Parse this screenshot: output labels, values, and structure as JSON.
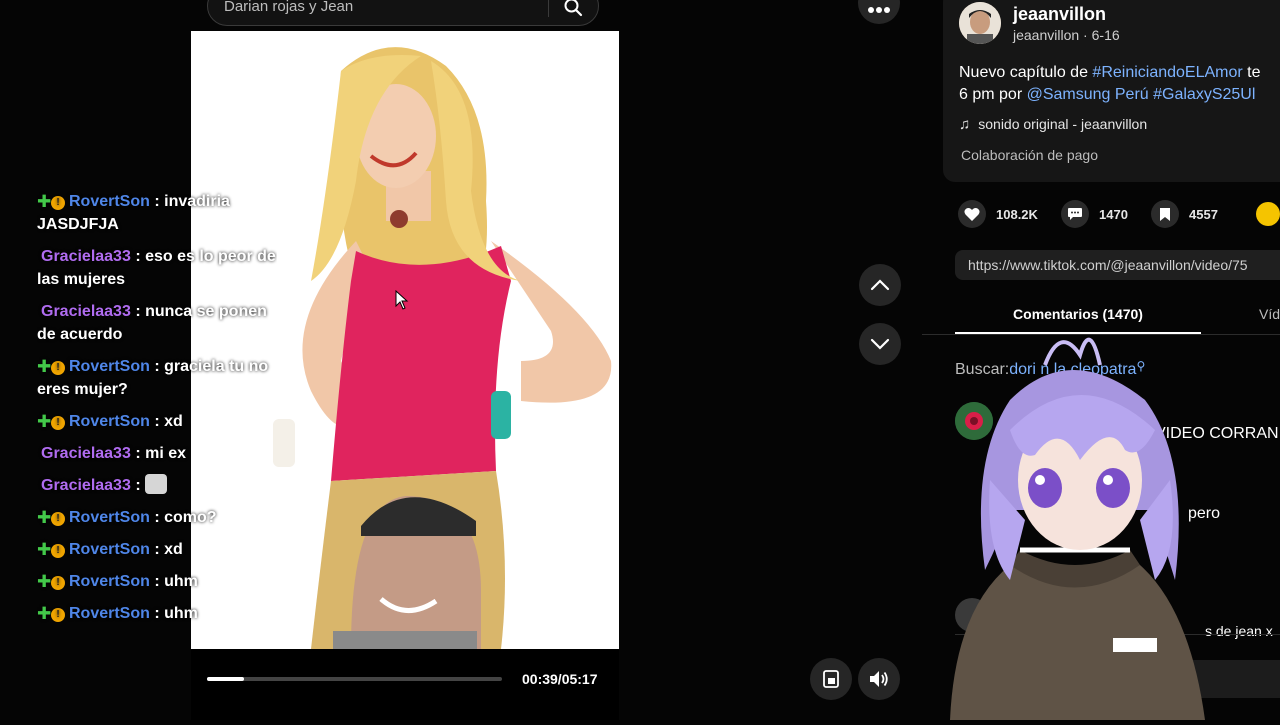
{
  "search": {
    "query": "Darian rojas y Jean"
  },
  "player": {
    "time": "00:39/05:17",
    "progress": 0.125
  },
  "chat": [
    {
      "user": "RovertSon",
      "badges": true,
      "text": ": invadiria JASDJFJA"
    },
    {
      "user": "Gracielaa33",
      "badges": false,
      "text": ": eso es lo peor de las mujeres"
    },
    {
      "user": "Gracielaa33",
      "badges": false,
      "text": ": nunca se ponen de acuerdo"
    },
    {
      "user": "RovertSon",
      "badges": true,
      "text": ": graciela tu no eres mujer?"
    },
    {
      "user": "RovertSon",
      "badges": true,
      "text": ": xd"
    },
    {
      "user": "Gracielaa33",
      "badges": false,
      "text": ": mi ex"
    },
    {
      "user": "Gracielaa33",
      "badges": false,
      "text": ":",
      "emote": "cat-emote"
    },
    {
      "user": "RovertSon",
      "badges": true,
      "text": ": como?"
    },
    {
      "user": "RovertSon",
      "badges": true,
      "text": ": xd"
    },
    {
      "user": "RovertSon",
      "badges": true,
      "text": ": uhm"
    },
    {
      "user": "RovertSon",
      "badges": true,
      "text": ": uhm"
    }
  ],
  "author": {
    "display_name": "jeaanvillon",
    "handle": "jeaanvillon",
    "date": "6-16"
  },
  "description": {
    "line1_prefix": "Nuevo capítulo de ",
    "tag1": "#ReiniciandoELAmor",
    "line1_suffix": " te",
    "line2_prefix": "6 pm por ",
    "mention": "@Samsung Perú",
    "tag2": "#GalaxyS25Ul"
  },
  "sound": "sonido original - jeaanvillon",
  "collab": "Colaboración de pago",
  "stats": {
    "likes": "108.2K",
    "comments": "1470",
    "saves": "4557"
  },
  "url": "https://www.tiktok.com/@jeaanvillon/video/75",
  "tabs": {
    "comments": "Comentarios (1470)",
    "videos": "Víd"
  },
  "buscar": {
    "label": "Buscar:",
    "query_start": "dori",
    "query_end": "n la cleopatra"
  },
  "comments_visible": [
    {
      "text": "VIDEO CORRAN"
    },
    {
      "text": "pero"
    },
    {
      "text": "s de jean x"
    }
  ],
  "colors": {
    "accent_link": "#7db3ff",
    "rovert": "#4f86e8",
    "graciela": "#b06cf0",
    "badge_plus": "#43c94a",
    "badge_coin": "#f0a500"
  }
}
